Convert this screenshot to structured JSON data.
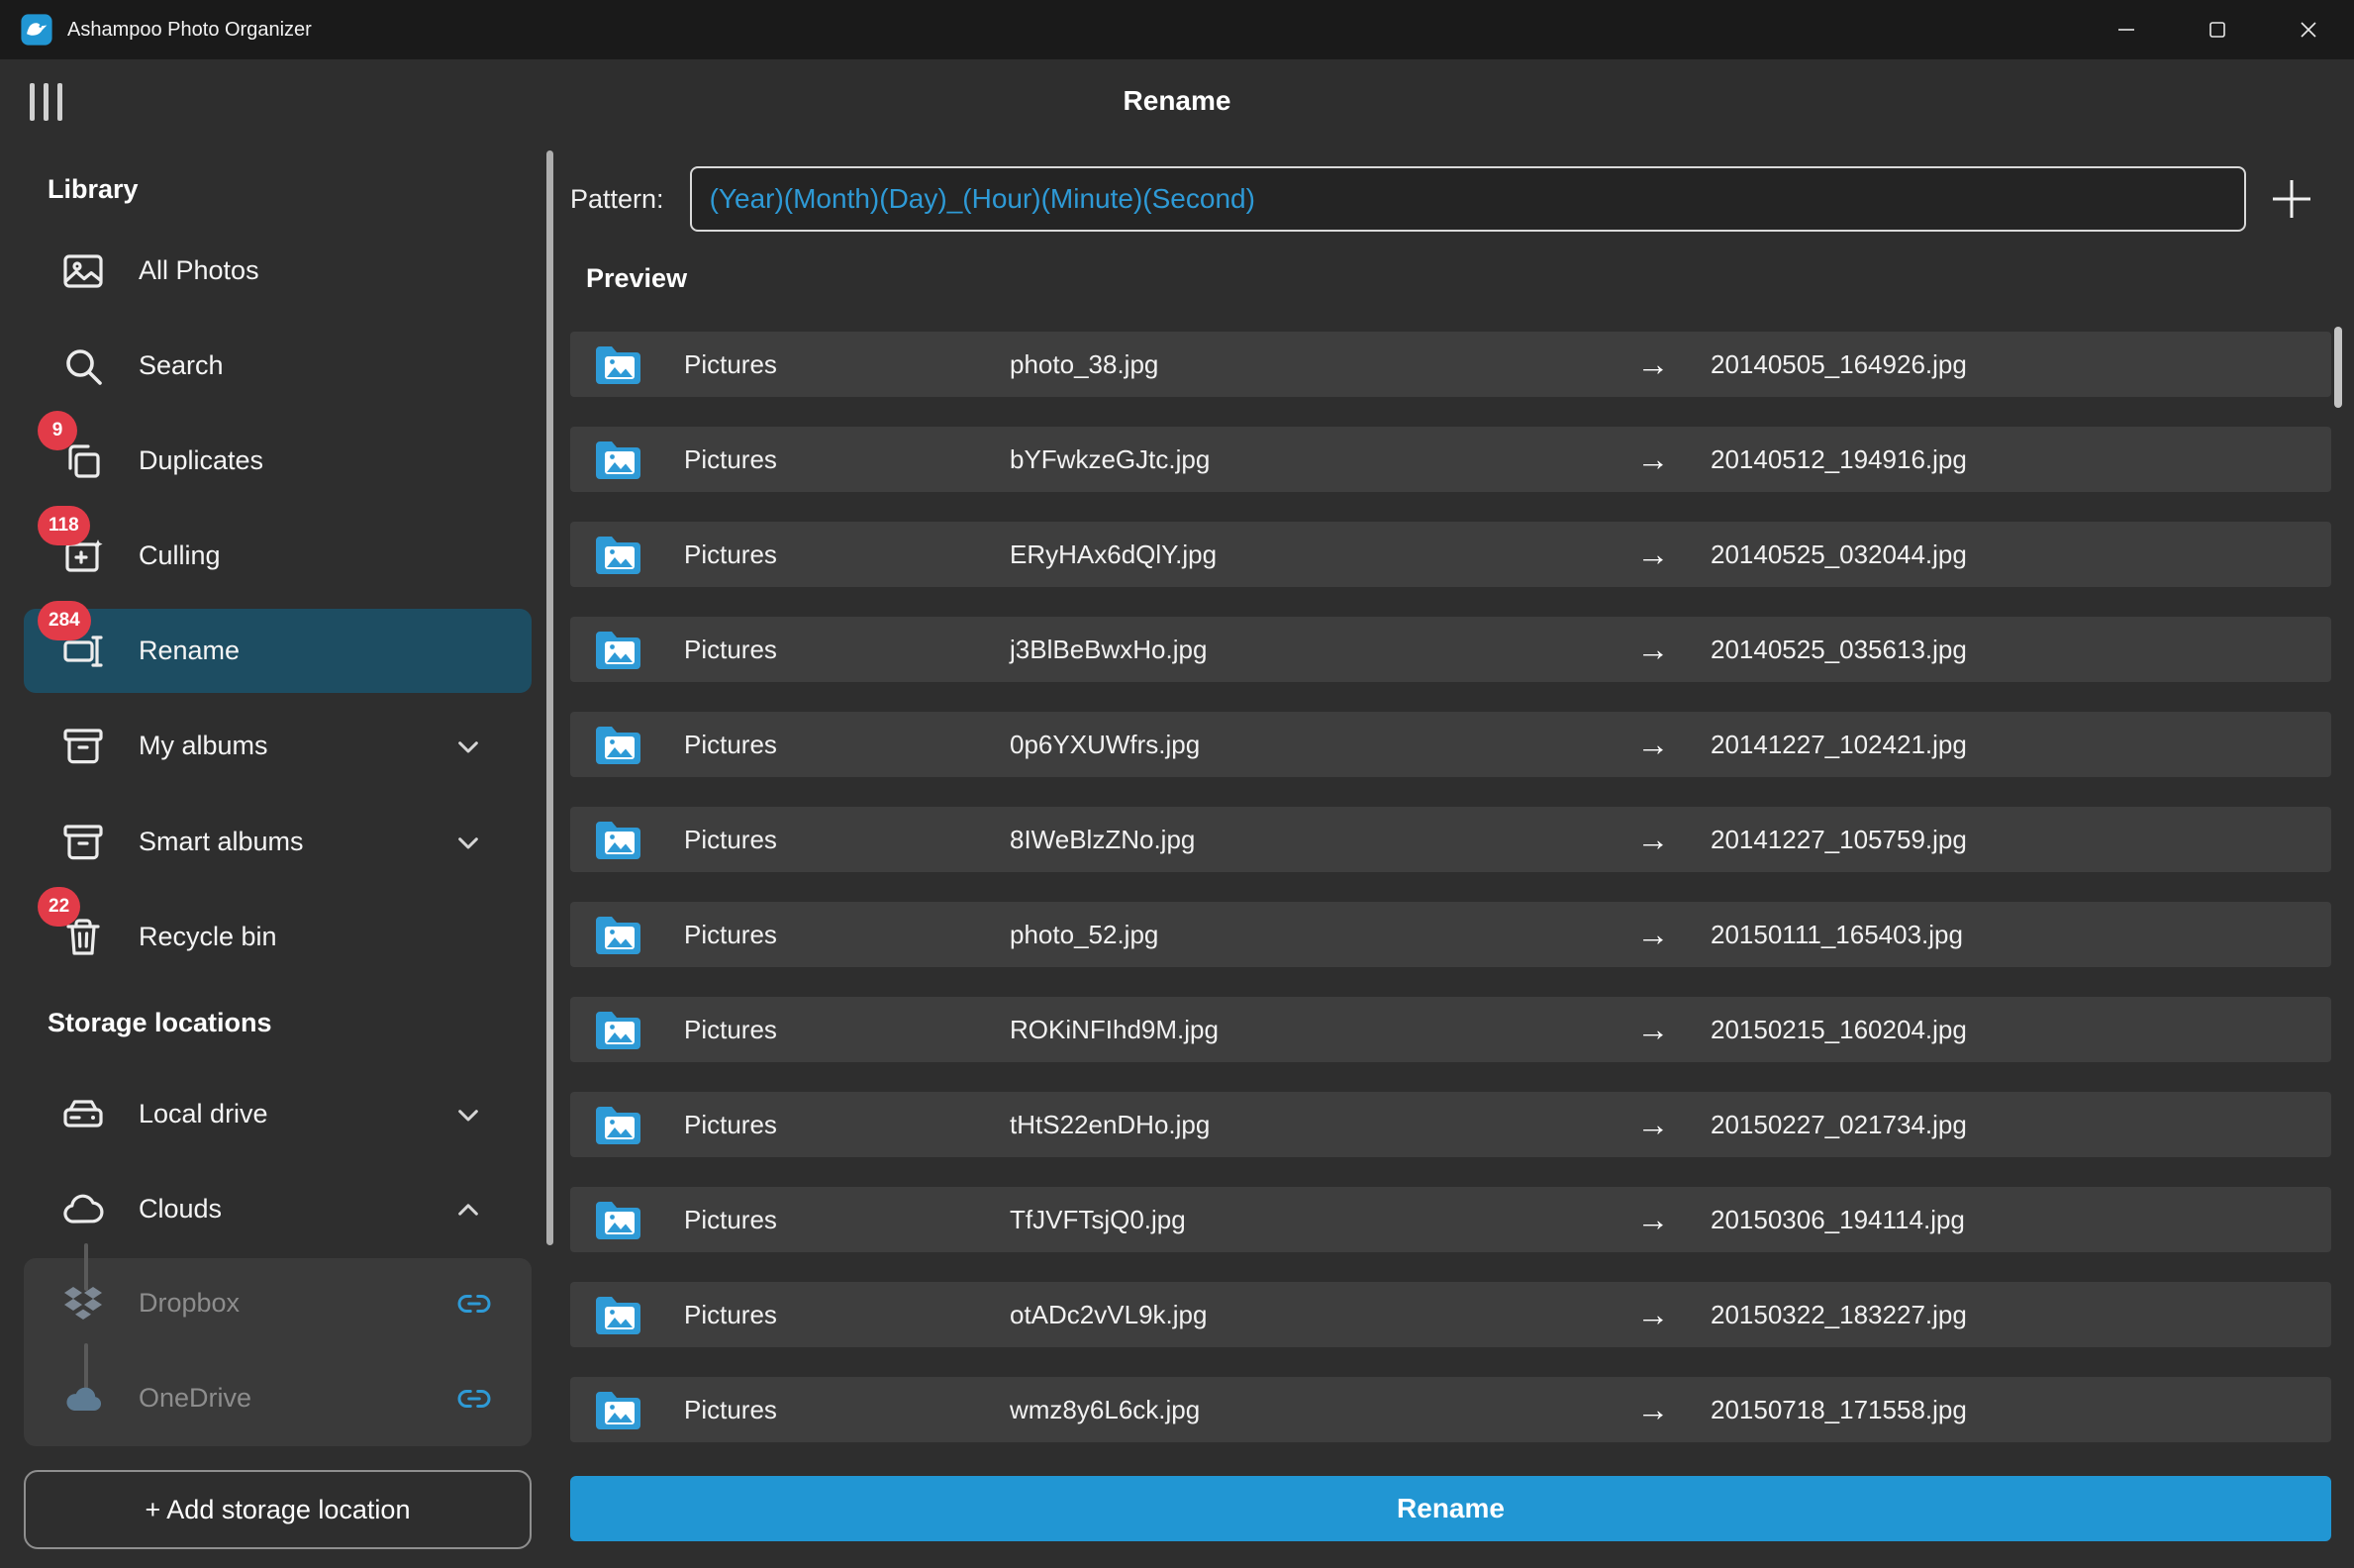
{
  "window": {
    "title": "Ashampoo Photo Organizer"
  },
  "header": {
    "title": "Rename"
  },
  "sidebar": {
    "library_heading": "Library",
    "items": [
      {
        "label": "All Photos"
      },
      {
        "label": "Search"
      },
      {
        "label": "Duplicates",
        "badge": "9"
      },
      {
        "label": "Culling",
        "badge": "118"
      },
      {
        "label": "Rename",
        "badge": "284",
        "selected": true
      },
      {
        "label": "My albums"
      },
      {
        "label": "Smart albums"
      },
      {
        "label": "Recycle bin",
        "badge": "22"
      }
    ],
    "storage_heading": "Storage locations",
    "storage_items": [
      {
        "label": "Local drive"
      },
      {
        "label": "Clouds"
      },
      {
        "label": "Dropbox",
        "linked": true
      },
      {
        "label": "OneDrive",
        "linked": true
      }
    ],
    "add_storage_label": "+ Add storage location"
  },
  "pattern": {
    "label": "Pattern:",
    "value": "(Year)(Month)(Day)_(Hour)(Minute)(Second)"
  },
  "preview": {
    "heading": "Preview",
    "arrow": "→",
    "rows": [
      {
        "folder": "Pictures",
        "from": "photo_38.jpg",
        "to": "20140505_164926.jpg"
      },
      {
        "folder": "Pictures",
        "from": "bYFwkzeGJtc.jpg",
        "to": "20140512_194916.jpg"
      },
      {
        "folder": "Pictures",
        "from": "ERyHAx6dQlY.jpg",
        "to": "20140525_032044.jpg"
      },
      {
        "folder": "Pictures",
        "from": "j3BlBeBwxHo.jpg",
        "to": "20140525_035613.jpg"
      },
      {
        "folder": "Pictures",
        "from": "0p6YXUWfrs.jpg",
        "to": "20141227_102421.jpg"
      },
      {
        "folder": "Pictures",
        "from": "8IWeBlzZNo.jpg",
        "to": "20141227_105759.jpg"
      },
      {
        "folder": "Pictures",
        "from": "photo_52.jpg",
        "to": "20150111_165403.jpg"
      },
      {
        "folder": "Pictures",
        "from": "ROKiNFIhd9M.jpg",
        "to": "20150215_160204.jpg"
      },
      {
        "folder": "Pictures",
        "from": "tHtS22enDHo.jpg",
        "to": "20150227_021734.jpg"
      },
      {
        "folder": "Pictures",
        "from": "TfJVFTsjQ0.jpg",
        "to": "20150306_194114.jpg"
      },
      {
        "folder": "Pictures",
        "from": "otADc2vVL9k.jpg",
        "to": "20150322_183227.jpg"
      },
      {
        "folder": "Pictures",
        "from": "wmz8y6L6ck.jpg",
        "to": "20150718_171558.jpg"
      }
    ]
  },
  "rename_button_label": "Rename",
  "icons": {
    "minimize": "─",
    "maximize": "▢",
    "close": "✕",
    "plus": "+",
    "arrow": "→"
  },
  "colors": {
    "accent": "#2196d3",
    "pattern_text": "#2e9ad6",
    "badge": "#e23b48",
    "selected_item": "#1d4d62",
    "row_bg": "#3e3e3e",
    "titlebar_bg": "#1a1a1a",
    "app_bg": "#2e2e2e"
  }
}
